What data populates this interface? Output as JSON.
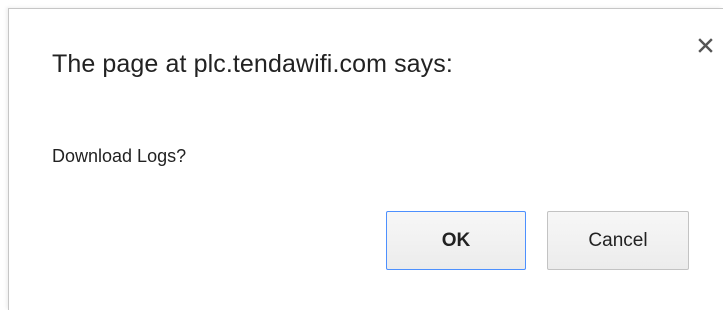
{
  "dialog": {
    "title": "The page at plc.tendawifi.com says:",
    "message": "Download Logs?",
    "close_icon": "close-icon",
    "buttons": {
      "ok_label": "OK",
      "cancel_label": "Cancel"
    },
    "colors": {
      "focus_border": "#4d90fe",
      "text": "#222222"
    }
  }
}
